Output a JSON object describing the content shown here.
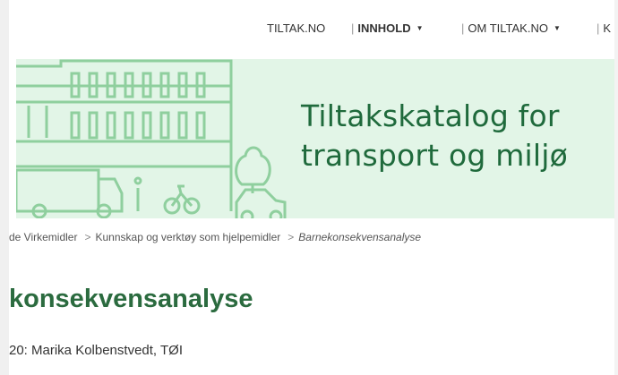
{
  "nav": {
    "items": [
      {
        "label": "TILTAK.NO",
        "sep": "",
        "caret": false,
        "bold": false
      },
      {
        "label": "INNHOLD",
        "sep": "|",
        "caret": true,
        "bold": true
      },
      {
        "label": "OM TILTAK.NO",
        "sep": "|",
        "caret": true,
        "bold": false
      },
      {
        "label": "K",
        "sep": "|",
        "caret": false,
        "bold": false
      }
    ],
    "caret_glyph": "▼"
  },
  "banner": {
    "title_line1": "Tiltakskatalog for",
    "title_line2": "transport og miljø",
    "accent_color": "#1f6a3c",
    "background_color": "#e2f5e7",
    "illustration_icons": [
      "building-icon",
      "truck-icon",
      "bicycle-icon",
      "car-icon",
      "tree-icon",
      "person-icon"
    ]
  },
  "breadcrumb": {
    "items": [
      "de Virkemidler",
      "Kunnskap og verktøy som hjelpemidler",
      "Barnekonsekvensanalyse"
    ],
    "separator": ">"
  },
  "article": {
    "title": "konsekvensanalyse",
    "byline": "20: Marika Kolbenstvedt, TØI",
    "title_color": "#2b6b3f"
  }
}
